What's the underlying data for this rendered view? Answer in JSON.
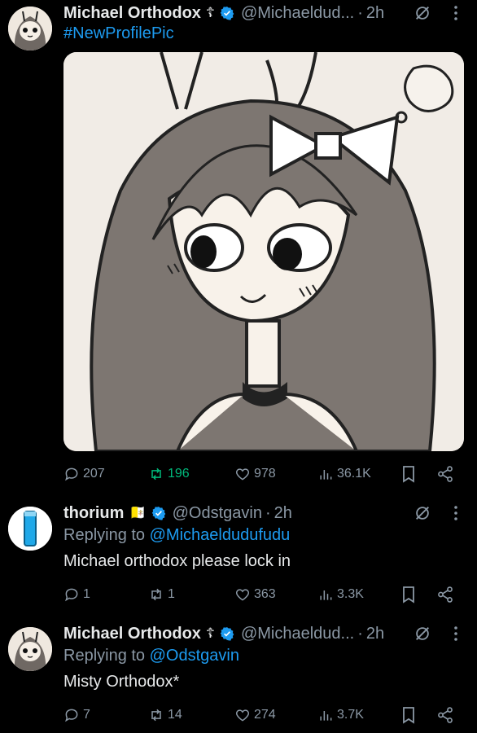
{
  "tweets": [
    {
      "name": "Michael Orthodox",
      "emoji": "☦",
      "handle": "@Michaeldud...",
      "time": "2h",
      "text": "#NewProfilePic",
      "stats": {
        "replies": "207",
        "reposts": "196",
        "likes": "978",
        "views": "36.1K"
      }
    },
    {
      "name": "thorium",
      "emoji": "🇻🇦",
      "handle": "@Odstgavin",
      "time": "2h",
      "replying_prefix": "Replying to",
      "replying_to": "@Michaeldudufudu",
      "text": "Michael orthodox please lock in",
      "stats": {
        "replies": "1",
        "reposts": "1",
        "likes": "363",
        "views": "3.3K"
      }
    },
    {
      "name": "Michael Orthodox",
      "emoji": "☦",
      "handle": "@Michaeldud...",
      "time": "2h",
      "replying_prefix": "Replying to",
      "replying_to": "@Odstgavin",
      "text": "Misty Orthodox*",
      "stats": {
        "replies": "7",
        "reposts": "14",
        "likes": "274",
        "views": "3.7K"
      }
    }
  ],
  "colors": {
    "accent": "#1d9bf0",
    "muted": "#8b98a5",
    "repost_active": "#00ba7c",
    "background": "#000000"
  }
}
